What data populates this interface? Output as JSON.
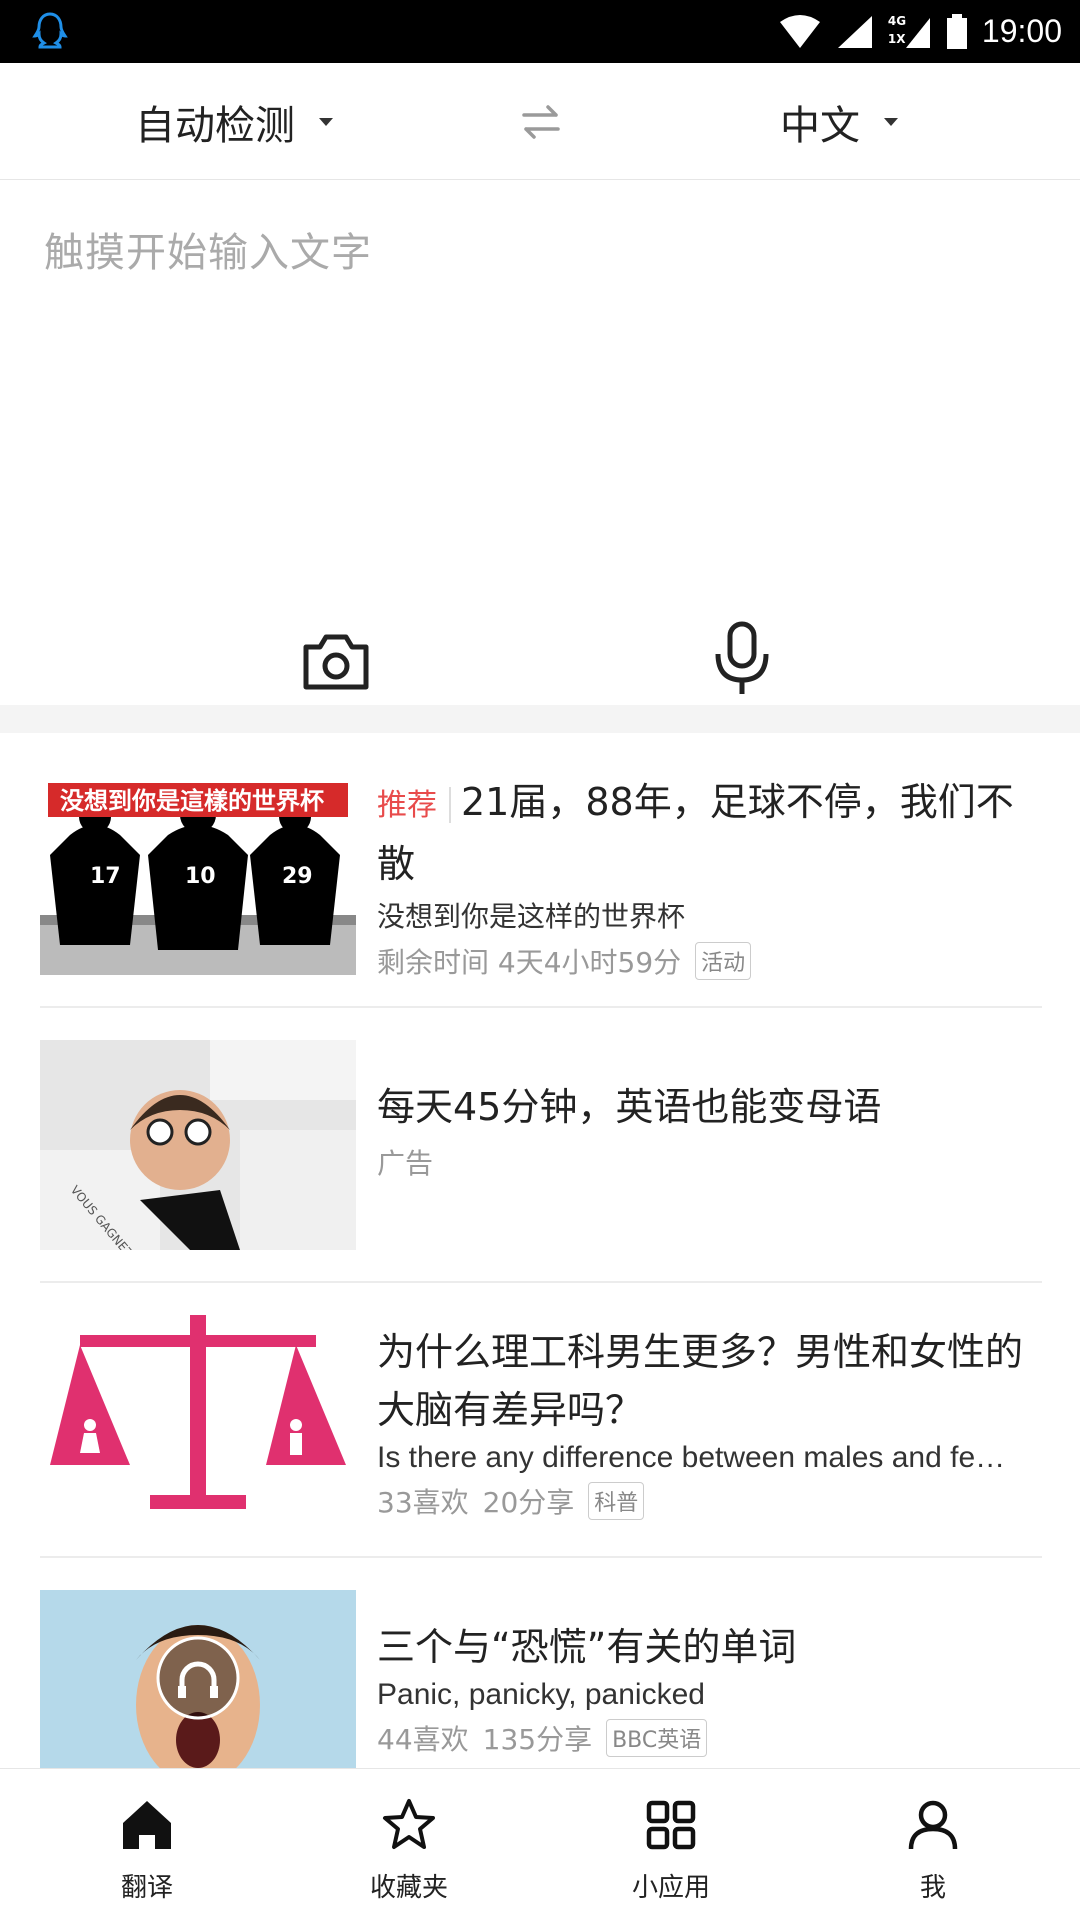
{
  "status_bar": {
    "time": "19:00",
    "network": "4G",
    "network_sub": "1X",
    "icons": [
      "qq-icon",
      "wifi-icon",
      "signal-icon",
      "signal-4g-icon",
      "battery-icon"
    ]
  },
  "language_bar": {
    "source_lang": "自动检测",
    "target_lang": "中文",
    "swap_icon": "swap-icon"
  },
  "input": {
    "placeholder": "触摸开始输入文字",
    "camera_icon": "camera-icon",
    "mic_icon": "microphone-icon"
  },
  "feed": [
    {
      "recommend_tag": "推荐",
      "title": "21届，88年，足球不停，我们不散",
      "subtitle": "没想到你是这样的世界杯",
      "meta": "剩余时间 4天4小时59分",
      "chip": "活动",
      "thumb_caption": "没想到你是這樣的世界杯",
      "jersey_numbers": [
        "17",
        "10",
        "29"
      ]
    },
    {
      "title": "每天45分钟，英语也能变母语",
      "meta": "广告",
      "thumb_caption": "VOUS GAGNEZ"
    },
    {
      "title": "为什么理工科男生更多？男性和女性的大脑有差异吗？",
      "subtitle": "Is there any difference between males and fe…",
      "likes": "33喜欢",
      "shares": "20分享",
      "chip": "科普"
    },
    {
      "title": "三个与“恐慌”有关的单词",
      "subtitle": "Panic, panicky, panicked",
      "likes": "44喜欢",
      "shares": "135分享",
      "chip": "BBC英语"
    }
  ],
  "bottom_nav": [
    {
      "label": "翻译",
      "icon": "home-icon",
      "active": true
    },
    {
      "label": "收藏夹",
      "icon": "star-icon",
      "active": false
    },
    {
      "label": "小应用",
      "icon": "apps-grid-icon",
      "active": false
    },
    {
      "label": "我",
      "icon": "user-icon",
      "active": false
    }
  ],
  "colors": {
    "accent_red": "#e84b4b",
    "status_bar": "#000000",
    "qq_blue": "#1f8fe8"
  }
}
